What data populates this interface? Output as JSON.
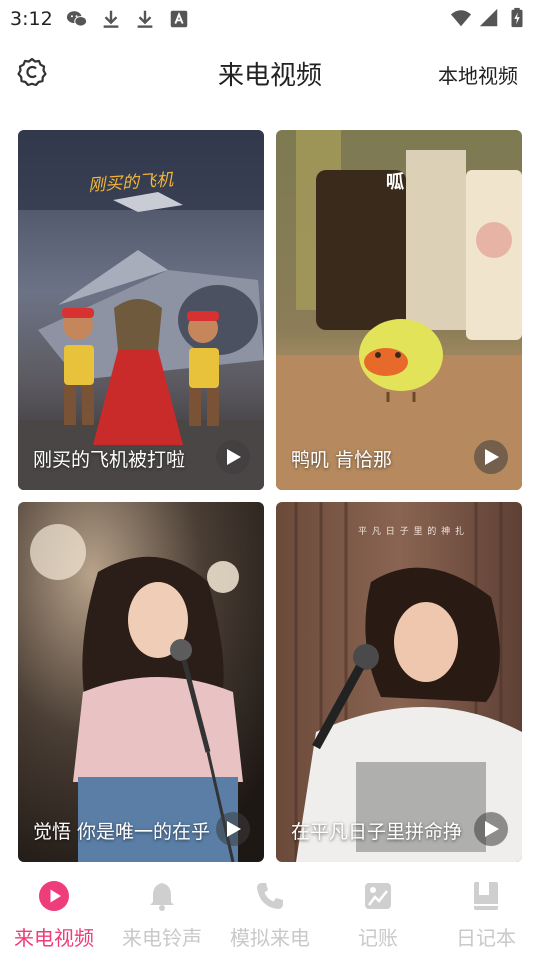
{
  "status_bar": {
    "time": "3:12",
    "left_icons": [
      "wechat-icon",
      "download-icon",
      "download-icon",
      "font-a-icon"
    ],
    "right_icons": [
      "wifi-icon",
      "cellular-signal-icon",
      "battery-charging-icon"
    ]
  },
  "header": {
    "settings_icon": "settings-refresh-icon",
    "title": "来电视频",
    "local_video_label": "本地视频"
  },
  "videos": [
    {
      "title": "刚买的飞机被打啦",
      "overlay_text": "刚买的飞机",
      "play_icon": "play-icon"
    },
    {
      "title": "鸭叽 肯恰那",
      "overlay_text": "呱",
      "play_icon": "play-icon"
    },
    {
      "title": "觉悟 你是唯一的在乎",
      "overlay_text": "",
      "play_icon": "play-icon"
    },
    {
      "title": "在平凡日子里拼命挣",
      "overlay_text": "平 凡 日 子 里 的 神 扎",
      "play_icon": "play-icon"
    }
  ],
  "bottom_nav": {
    "active_color": "#ee3d7a",
    "inactive_color": "#c9c9c9",
    "items": [
      {
        "label": "来电视频",
        "icon": "play-circle-icon",
        "active": true
      },
      {
        "label": "来电铃声",
        "icon": "bell-icon",
        "active": false
      },
      {
        "label": "模拟来电",
        "icon": "phone-icon",
        "active": false
      },
      {
        "label": "记账",
        "icon": "ledger-icon",
        "active": false
      },
      {
        "label": "日记本",
        "icon": "diary-book-icon",
        "active": false
      }
    ]
  }
}
